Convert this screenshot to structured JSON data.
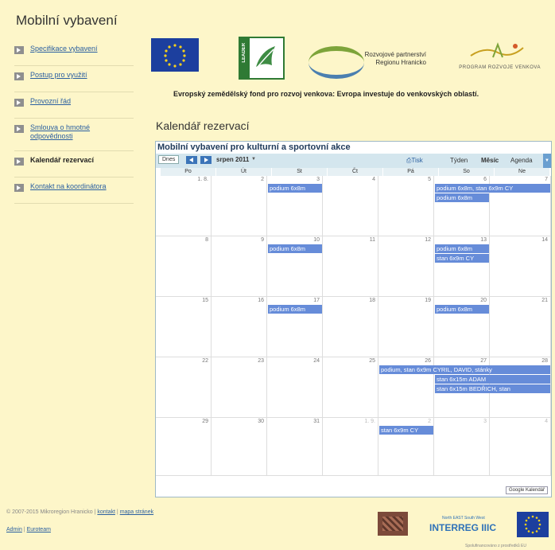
{
  "page": {
    "title": "Mobilní vybavení"
  },
  "sidebar": {
    "items": [
      {
        "label": "Specifikace vybavení"
      },
      {
        "label": "Postup pro využití"
      },
      {
        "label": "Provozní řád"
      },
      {
        "label": "Smlouva o hmotné odpovědnosti"
      },
      {
        "label": "Kalendář rezervací"
      },
      {
        "label": "Kontakt na koordinátora"
      }
    ]
  },
  "logos": {
    "leader": "LEADER",
    "rpr_line1": "Rozvojové partnerství",
    "rpr_line2": "Regionu Hranicko",
    "prv": "PROGRAM ROZVOJE VENKOVA"
  },
  "eafrd": "Evropský zemědělský fond pro rozvoj venkova: Evropa investuje do venkovských oblastí.",
  "calendar_heading": "Kalendář rezervací",
  "calendar": {
    "title": "Mobilní vybavení pro kulturní a sportovní akce",
    "today": "Dnes",
    "month": "srpen 2011",
    "print": "Tisk",
    "tabs": [
      "Týden",
      "Měsíc",
      "Agenda"
    ],
    "days": [
      "Po",
      "Út",
      "St",
      "Čt",
      "Pá",
      "So",
      "Ne"
    ],
    "weeks": [
      [
        "1. 8.",
        "2",
        "3",
        "4",
        "5",
        "6",
        "7"
      ],
      [
        "8",
        "9",
        "10",
        "11",
        "12",
        "13",
        "14"
      ],
      [
        "15",
        "16",
        "17",
        "18",
        "19",
        "20",
        "21"
      ],
      [
        "22",
        "23",
        "24",
        "25",
        "26",
        "27",
        "28"
      ],
      [
        "29",
        "30",
        "31",
        "1. 9.",
        "2",
        "3",
        "4"
      ]
    ],
    "events": {
      "w0_st": "podium 6x8m",
      "w0_so_a": "podium 6x8m, stan 6x9m CY",
      "w0_so_b": "podium 6x8m",
      "w1_st": "podium 6x8m",
      "w1_so_a": "podium 6x8m",
      "w1_so_b": "stan 6x9m CY",
      "w2_st": "podium 6x8m",
      "w2_so": "podium 6x8m",
      "w3_pa": "podium, stan 6x9m CYRIL, DAVID, stánky",
      "w3_so_b": "stan 6x15m ADAM",
      "w3_so_c": "stan 6x15m BEDŘICH, stan",
      "w4_pa": "stan 6x9m CY"
    },
    "google": "Google Kalendář"
  },
  "footer": {
    "copyright": "© 2007-2015 Mikroregion Hranicko |",
    "kontakt": "kontakt",
    "sep": "|",
    "mapa": "mapa stránek",
    "admin": "Admin",
    "pipe": "|",
    "euroteam": "Euroteam",
    "interreg_small": "North EAST South West",
    "interreg": "INTERREG IIIC",
    "spolu": "Spolufinancováno z prostředků EU"
  }
}
